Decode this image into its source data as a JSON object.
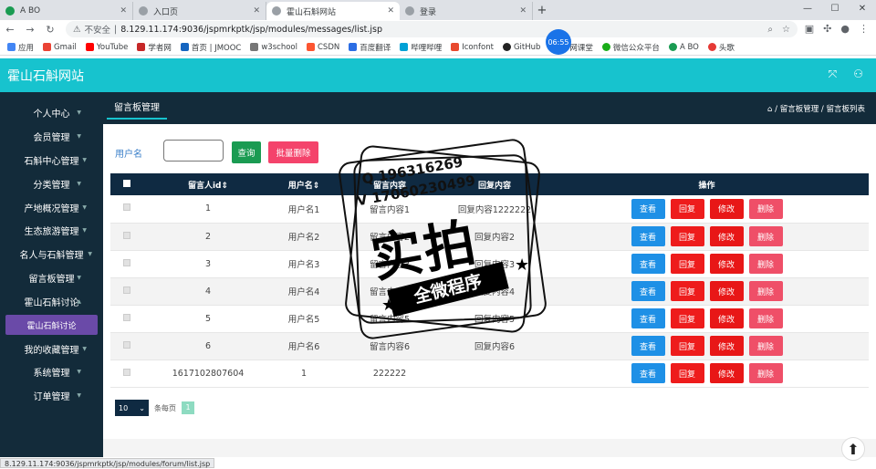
{
  "browser": {
    "tabs": [
      {
        "title": "A BO",
        "color": "#1a9b52"
      },
      {
        "title": "入口页",
        "color": "#5f6368"
      },
      {
        "title": "霍山石斛网站",
        "color": "#5f6368"
      },
      {
        "title": "登录",
        "color": "#5f6368"
      }
    ],
    "security_text": "不安全",
    "url": "8.129.11.174:9036/jspmrkptk/jsp/modules/messages/list.jsp",
    "clock": "06:55",
    "bookmarks": [
      {
        "label": "应用",
        "color": "#4285f4"
      },
      {
        "label": "Gmail",
        "color": "#ea4335"
      },
      {
        "label": "YouTube",
        "color": "#ff0000"
      },
      {
        "label": "学者网",
        "color": "#c62828"
      },
      {
        "label": "首页 | JMOOC",
        "color": "#1565c0"
      },
      {
        "label": "w3school",
        "color": "#777777"
      },
      {
        "label": "CSDN",
        "color": "#fc5531"
      },
      {
        "label": "百度翻译",
        "color": "#2b6de4"
      },
      {
        "label": "哔哩哔哩",
        "color": "#00a1d6"
      },
      {
        "label": "Iconfont",
        "color": "#e84a2f"
      },
      {
        "label": "GitHub",
        "color": "#222222"
      },
      {
        "label": "网课堂",
        "color": "#3f51b5"
      },
      {
        "label": "微信公众平台",
        "color": "#1aad19"
      },
      {
        "label": "A BO",
        "color": "#1a9b52"
      },
      {
        "label": "头歌",
        "color": "#e53935"
      }
    ],
    "status_url": "8.129.11.174:9036/jspmrkptk/jsp/modules/forum/list.jsp"
  },
  "header": {
    "site_title": "霍山石斛网站"
  },
  "sidebar": {
    "items": [
      {
        "label": "个人中心"
      },
      {
        "label": "会员管理"
      },
      {
        "label": "石斛中心管理"
      },
      {
        "label": "分类管理"
      },
      {
        "label": "产地概况管理"
      },
      {
        "label": "生态旅游管理"
      },
      {
        "label": "名人与石斛管理"
      },
      {
        "label": "留言板管理"
      },
      {
        "label": "霍山石斛讨论"
      }
    ],
    "sub_item": "霍山石斛讨论",
    "items_after": [
      {
        "label": "我的收藏管理"
      },
      {
        "label": "系统管理"
      },
      {
        "label": "订单管理"
      }
    ]
  },
  "main": {
    "tab_label": "留言板管理",
    "breadcrumb": "留言板管理 / 留言板列表",
    "search_label": "用户名",
    "search_value": "",
    "search_button": "查询",
    "batch_delete_button": "批量删除",
    "table": {
      "headers": [
        "留言人id",
        "用户名",
        "留言内容",
        "回复内容",
        "操作"
      ],
      "rows": [
        [
          "1",
          "用户名1",
          "留言内容1",
          "回复内容1222222"
        ],
        [
          "2",
          "用户名2",
          "留言内容2",
          "回复内容2"
        ],
        [
          "3",
          "用户名3",
          "留言内容3",
          "回复内容3"
        ],
        [
          "4",
          "用户名4",
          "留言内容4",
          "回复内容4"
        ],
        [
          "5",
          "用户名5",
          "留言内容5",
          "回复内容5"
        ],
        [
          "6",
          "用户名6",
          "留言内容6",
          "回复内容6"
        ],
        [
          "1617102807604",
          "1",
          "222222",
          ""
        ]
      ],
      "actions": [
        "查看",
        "回复",
        "修改",
        "删除"
      ]
    },
    "pager": {
      "page_size": "10",
      "per_page_label": "条每页",
      "current_page": "1"
    }
  },
  "watermark": {
    "qq": "Q 196316269",
    "wx": "V 17060230499",
    "main": "实拍",
    "ribbon": "全微程序"
  }
}
